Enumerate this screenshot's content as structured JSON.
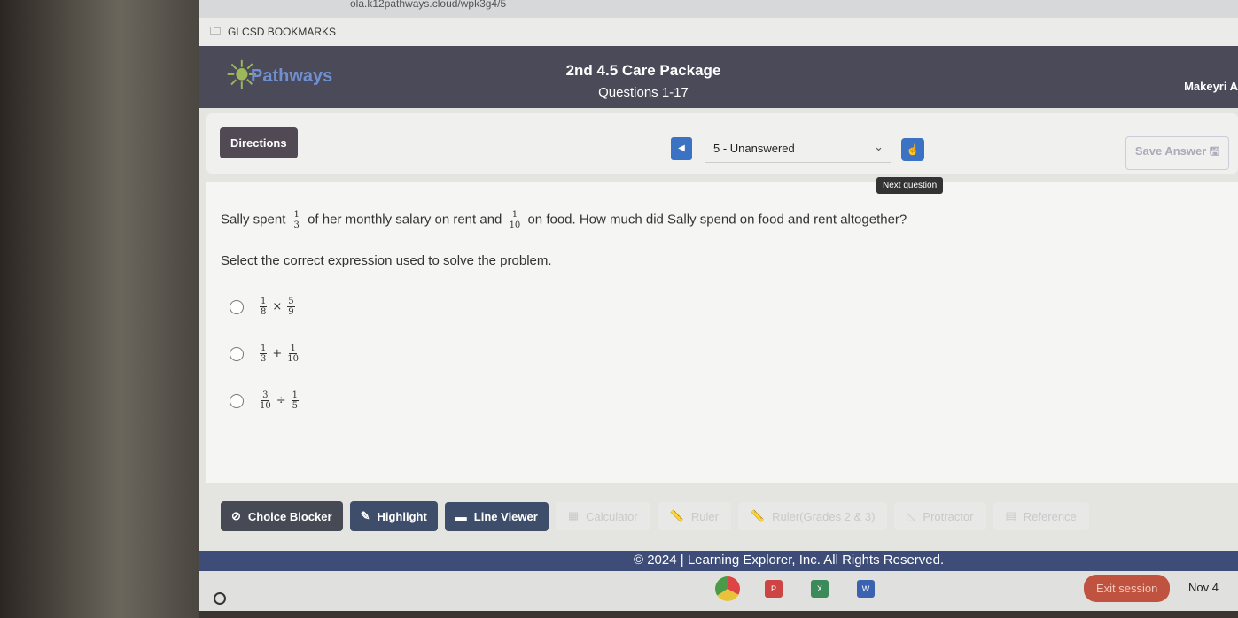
{
  "browser": {
    "url": "ola.k12pathways.cloud/wpk3g4/5",
    "bookmarks_label": "GLCSD BOOKMARKS"
  },
  "header": {
    "logo": "Pathways",
    "title": "2nd 4.5 Care Package",
    "subtitle": "Questions 1-17",
    "user": "Makeyri A"
  },
  "toolbar": {
    "directions": "Directions",
    "question_select": "5 - Unanswered",
    "next_tooltip": "Next question",
    "save": "Save Answer"
  },
  "question": {
    "text_1": "Sally spent",
    "frac_1": [
      "1",
      "3"
    ],
    "text_2": "of her monthly salary on rent and",
    "frac_2": [
      "1",
      "10"
    ],
    "text_3": "on food.  How much did Sally spend on food and rent altogether?",
    "instruction": "Select the correct expression used to solve the problem.",
    "options": [
      {
        "a": [
          "1",
          "8"
        ],
        "op": "×",
        "b": [
          "5",
          "9"
        ]
      },
      {
        "a": [
          "1",
          "3"
        ],
        "op": "+",
        "b": [
          "1",
          "10"
        ]
      },
      {
        "a": [
          "3",
          "10"
        ],
        "op": "÷",
        "b": [
          "1",
          "5"
        ]
      }
    ]
  },
  "tools": {
    "choice_blocker": "Choice Blocker",
    "highlight": "Highlight",
    "line_viewer": "Line Viewer",
    "calculator": "Calculator",
    "ruler": "Ruler",
    "ruler_23": "Ruler(Grades 2 & 3)",
    "protractor": "Protractor",
    "reference": "Reference"
  },
  "footer": "© 2024 | Learning Explorer, Inc. All Rights Reserved.",
  "taskbar": {
    "exit": "Exit session",
    "date": "Nov 4"
  },
  "colors": {
    "header": "#4b4a58",
    "accent": "#3b72c4",
    "footer": "#3d4d78",
    "exit": "#c0533f"
  }
}
